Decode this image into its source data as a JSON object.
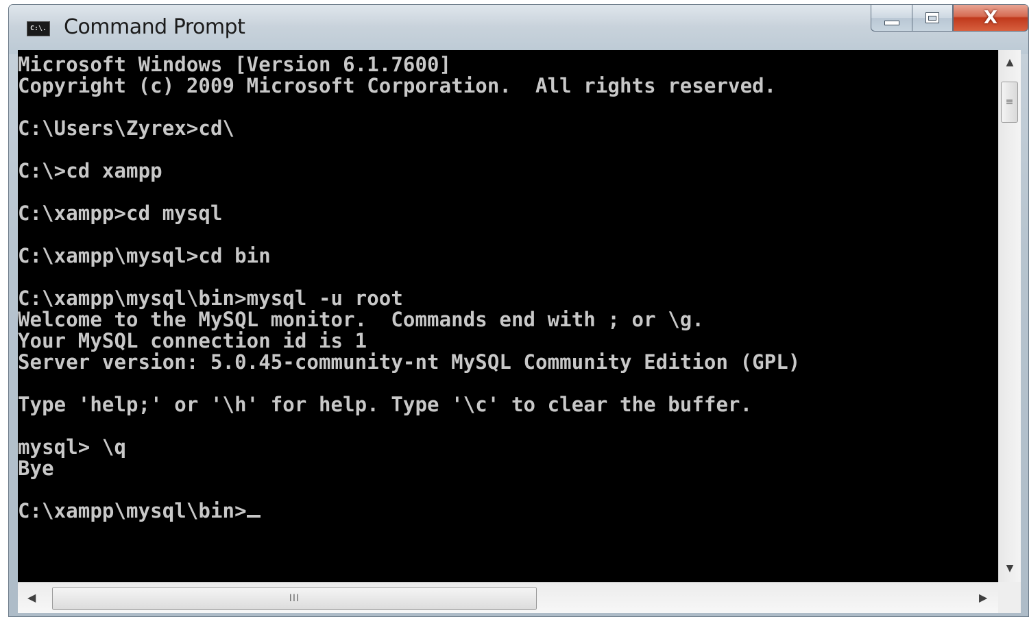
{
  "window": {
    "title": "Command Prompt",
    "icon_label": "C:\\.",
    "icons": {
      "app": "cmd-icon",
      "minimize": "minimize-icon",
      "maximize": "maximize-icon",
      "close": "close-icon"
    },
    "close_glyph": "X"
  },
  "console": {
    "lines": [
      "Microsoft Windows [Version 6.1.7600]",
      "Copyright (c) 2009 Microsoft Corporation.  All rights reserved.",
      "",
      "C:\\Users\\Zyrex>cd\\",
      "",
      "C:\\>cd xampp",
      "",
      "C:\\xampp>cd mysql",
      "",
      "C:\\xampp\\mysql>cd bin",
      "",
      "C:\\xampp\\mysql\\bin>mysql -u root",
      "Welcome to the MySQL monitor.  Commands end with ; or \\g.",
      "Your MySQL connection id is 1",
      "Server version: 5.0.45-community-nt MySQL Community Edition (GPL)",
      "",
      "Type 'help;' or '\\h' for help. Type '\\c' to clear the buffer.",
      "",
      "mysql> \\q",
      "Bye",
      "",
      "C:\\xampp\\mysql\\bin>"
    ],
    "text_color": "#c8c8c8",
    "background_color": "#000000"
  },
  "scrollbars": {
    "up_arrow": "▲",
    "down_arrow": "▼",
    "left_arrow": "◀",
    "right_arrow": "▶",
    "vertical_grip": "≡",
    "horizontal_grip": "III"
  },
  "colors": {
    "close_button": "#c0391c",
    "title_bar": "#c8d2db"
  }
}
